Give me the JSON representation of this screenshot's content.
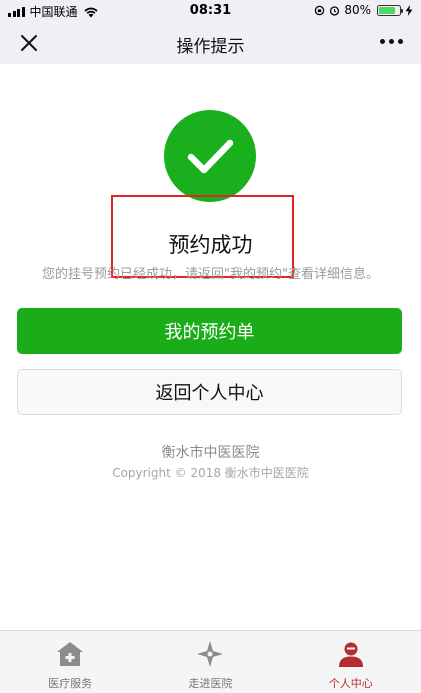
{
  "status_bar": {
    "carrier": "中国联通",
    "time": "08:31",
    "battery": "80%",
    "battery_level": 0.8
  },
  "nav": {
    "title": "操作提示",
    "close_icon": "close-icon",
    "more_icon": "more-icon"
  },
  "result": {
    "icon": "checkmark-icon",
    "title": "预约成功",
    "description": "您的挂号预约已经成功，请返回\"我的预约\"查看详细信息。"
  },
  "buttons": {
    "primary_label": "我的预约单",
    "secondary_label": "返回个人中心"
  },
  "footer": {
    "name": "衡水市中医医院",
    "copyright": "Copyright © 2018 衡水市中医医院"
  },
  "tabs": [
    {
      "label": "医疗服务",
      "icon": "hospital-icon",
      "active": false
    },
    {
      "label": "走进医院",
      "icon": "compass-icon",
      "active": false
    },
    {
      "label": "个人中心",
      "icon": "user-icon",
      "active": true
    }
  ],
  "colors": {
    "success_green": "#1aad19",
    "highlight_red": "#e22424",
    "active_tab": "#b32d2e"
  }
}
